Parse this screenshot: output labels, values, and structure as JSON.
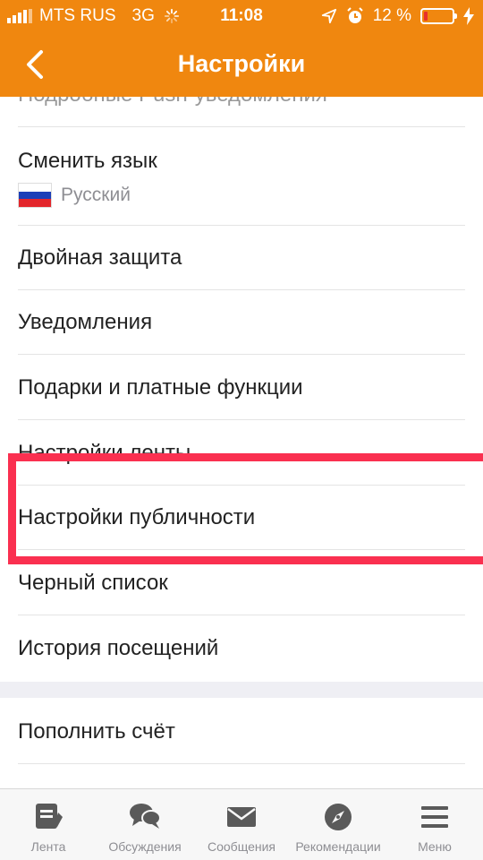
{
  "status_bar": {
    "carrier": "MTS RUS",
    "network": "3G",
    "time": "11:08",
    "battery_text": "12 %",
    "battery_level": 0.12,
    "battery_color": "#e8302c"
  },
  "header": {
    "title": "Настройки",
    "back_icon": "chevron-left-icon",
    "background": "#f0870f"
  },
  "settings": {
    "partial_item": "Подробные Push-уведомления",
    "language": {
      "label": "Сменить язык",
      "value": "Русский",
      "flag_icon": "russia-flag-icon"
    },
    "items": [
      "Двойная защита",
      "Уведомления",
      "Подарки и платные функции",
      "Настройки ленты",
      "Настройки публичности",
      "Черный список",
      "История посещений"
    ],
    "billing_items": [
      "Пополнить счёт"
    ]
  },
  "highlight": {
    "target": "Настройки публичности",
    "color": "#fa3050"
  },
  "tab_bar": {
    "tabs": [
      {
        "label": "Лента",
        "icon": "feed-icon"
      },
      {
        "label": "Обсуждения",
        "icon": "discussions-icon"
      },
      {
        "label": "Сообщения",
        "icon": "messages-icon"
      },
      {
        "label": "Рекомендации",
        "icon": "compass-icon"
      },
      {
        "label": "Меню",
        "icon": "menu-icon"
      }
    ]
  }
}
